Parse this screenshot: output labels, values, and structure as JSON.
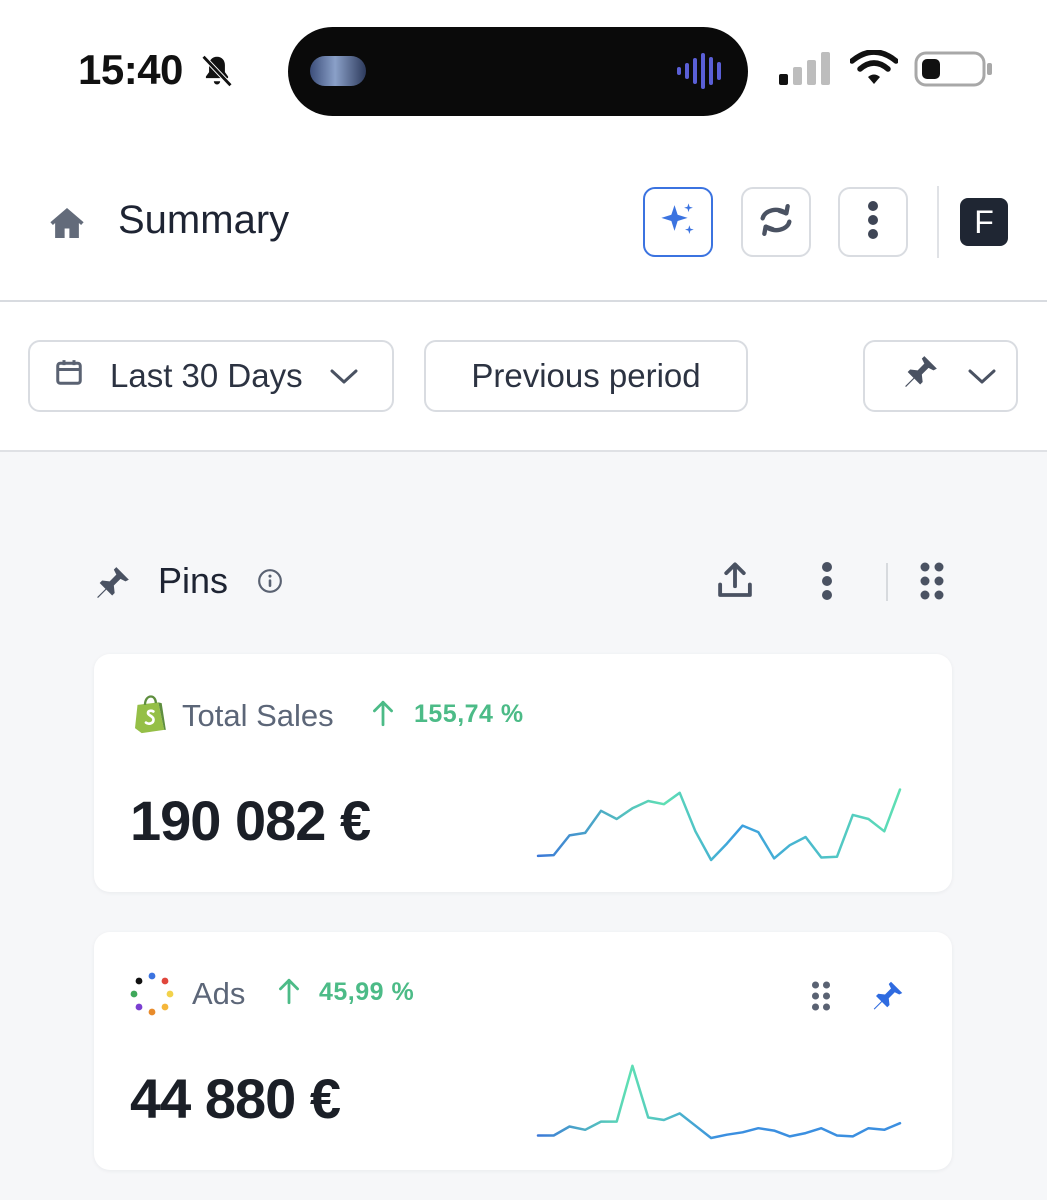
{
  "status_bar": {
    "time": "15:40",
    "icons": [
      "bell-slash-icon",
      "cellular-signal-icon",
      "wifi-icon",
      "battery-icon"
    ]
  },
  "header": {
    "title": "Summary",
    "avatar_letter": "F",
    "icons": [
      "home-icon",
      "sparkles-icon",
      "refresh-icon",
      "more-vertical-icon"
    ]
  },
  "filters": {
    "date_range": "Last 30 Days",
    "compare": "Previous period",
    "icons": [
      "calendar-icon",
      "chevron-down-icon",
      "pin-icon"
    ]
  },
  "pins": {
    "title": "Pins",
    "icons": [
      "pin-icon",
      "info-icon",
      "share-icon",
      "more-vertical-icon",
      "drag-grid-icon"
    ]
  },
  "cards": [
    {
      "name": "Total Sales",
      "change": "155,74 %",
      "value": "190 082 €",
      "icon": "shopify-bag-icon",
      "sparkline": [
        0.05,
        0.06,
        0.3,
        0.33,
        0.6,
        0.5,
        0.63,
        0.72,
        0.68,
        0.82,
        0.35,
        0.0,
        0.2,
        0.42,
        0.34,
        0.02,
        0.18,
        0.28,
        0.03,
        0.04,
        0.55,
        0.5,
        0.35,
        0.86
      ]
    },
    {
      "name": "Ads",
      "change": "45,99 %",
      "value": "44 880 €",
      "icon": "ads-dots-icon",
      "sparkline": [
        0.03,
        0.03,
        0.14,
        0.1,
        0.2,
        0.2,
        0.88,
        0.25,
        0.22,
        0.3,
        0.15,
        0.0,
        0.04,
        0.07,
        0.12,
        0.09,
        0.02,
        0.06,
        0.12,
        0.03,
        0.02,
        0.12,
        0.1,
        0.18
      ]
    }
  ],
  "colors": {
    "accent": "#3b73e0",
    "positive": "#4cbb87",
    "spark_start": "#3b78d8",
    "spark_end": "#5fe0b3"
  }
}
